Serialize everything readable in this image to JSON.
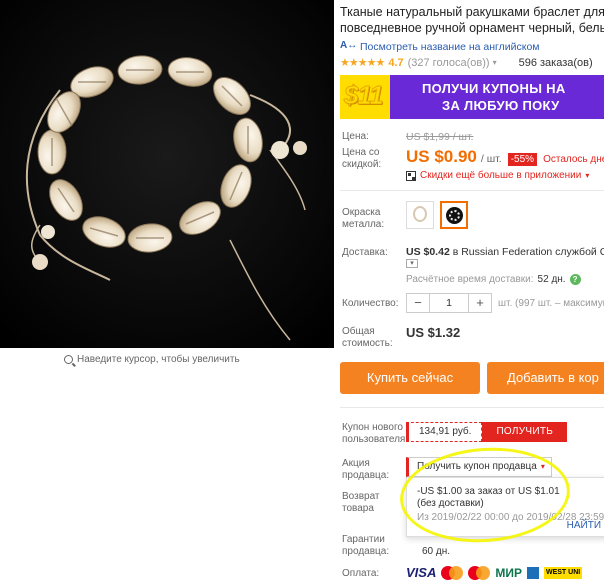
{
  "product": {
    "title_line1": "Тканые натуральный ракушками браслет для же",
    "title_line2": "повседневное ручной орнамент черный, белый",
    "translate_link": "Посмотреть название на английском",
    "rating": {
      "stars": "★★★★★",
      "score": "4.7",
      "votes": "(327 голоса(ов))",
      "orders": "596 заказа(ов)"
    },
    "zoom_hint": "Наведите курсор, чтобы увеличить"
  },
  "banner": {
    "amount": "$11",
    "line1": "ПОЛУЧИ КУПОНЫ НА",
    "line2": "ЗА ЛЮБУЮ ПОКУ"
  },
  "price": {
    "label": "Цена:",
    "old": "US $1,99 / шт.",
    "discount_label_1": "Цена со",
    "discount_label_2": "скидкой:",
    "new_amount": "US $0.90",
    "unit": "/ шт.",
    "discount_pct": "-55%",
    "remaining": "Осталось дне",
    "app_deal": "Скидки ещё больше в приложении"
  },
  "options": {
    "color_label_1": "Окраска",
    "color_label_2": "металла:"
  },
  "shipping": {
    "label": "Доставка:",
    "cost": "US $0.42",
    "text_pre": "в",
    "text_dest": "Russian Federation службой Chi",
    "eta_label": "Расчётное время доставки:",
    "eta_days": "52 дн."
  },
  "quantity": {
    "label": "Количество:",
    "minus": "−",
    "value": "1",
    "plus": "+",
    "note": "шт. (997 шт. – максимум на"
  },
  "total": {
    "label_1": "Общая",
    "label_2": "стоимость:",
    "value": "US $1.32"
  },
  "actions": {
    "buy_now": "Купить сейчас",
    "add_to_cart": "Добавить в кор"
  },
  "coupons": {
    "new_user_label_1": "Купон нового",
    "new_user_label_2": "пользователя",
    "new_user_amount": "134,91 руб.",
    "get_button": "ПОЛУЧИТЬ",
    "seller_label_1": "Акция",
    "seller_label_2": "продавца:",
    "seller_select": "Получить купон продавца",
    "popup_line1": "-US $1.00 за заказ от US $1.01",
    "popup_line2": "(без доставки)",
    "popup_line3": "Из 2019/02/22 00:00 до 2019/02/28 23:59",
    "popup_take": "НАЙТИ"
  },
  "returns": {
    "label_1": "Возврат",
    "label_2": "товара"
  },
  "guarantee": {
    "label_1": "Гарантии",
    "label_2": "продавца:",
    "delivery_days": "60 дн."
  },
  "payment": {
    "label": "Оплата:",
    "visa": "VISA",
    "mir": "МИР",
    "wu": "WEST UNI"
  },
  "colors": {
    "accent": "#f36d00",
    "red": "#e3251f",
    "link": "#2a5db0",
    "banner_purple": "#6a29d6",
    "banner_yellow": "#ffdd00",
    "highlight": "#f5f500"
  }
}
